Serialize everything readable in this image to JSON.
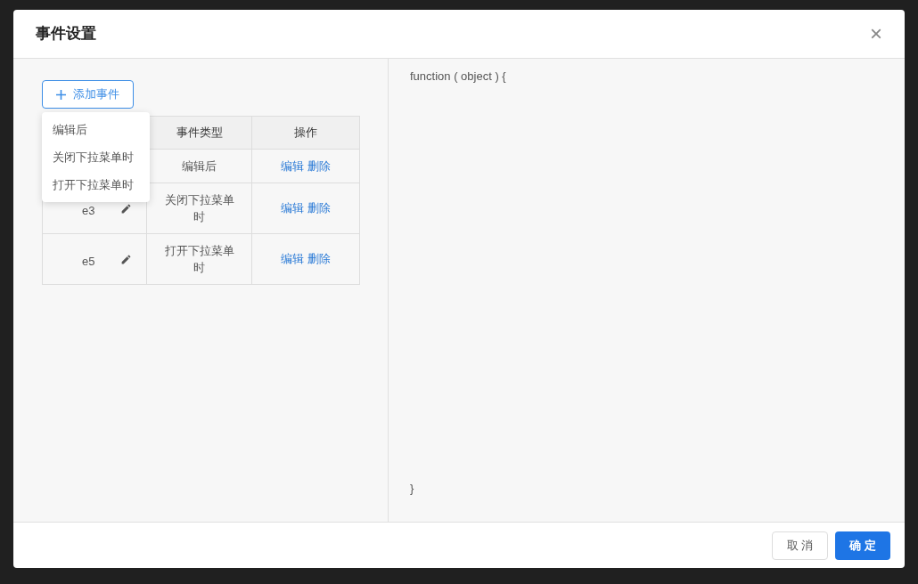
{
  "dialog": {
    "title": "事件设置",
    "close": "×"
  },
  "add_button": {
    "label": "添加事件"
  },
  "dropdown": {
    "items": [
      "编辑后",
      "关闭下拉菜单时",
      "打开下拉菜单时"
    ]
  },
  "table": {
    "columns": [
      "事件类型",
      "操作"
    ],
    "rows": [
      {
        "type": "编辑后",
        "actions": [
          "编辑",
          "删除"
        ]
      },
      {
        "name": "e3",
        "type": "关闭下拉菜单时",
        "actions": [
          "编辑",
          "删除"
        ]
      },
      {
        "name": "e5",
        "type": "打开下拉菜单时",
        "actions": [
          "编辑",
          "删除"
        ]
      }
    ]
  },
  "code": {
    "first_line": "function ( object ) {",
    "last_line": "}"
  },
  "footer": {
    "buttons": [
      {
        "label": "取 消",
        "kind": "secondary"
      },
      {
        "label": "确 定",
        "kind": "primary"
      }
    ]
  }
}
